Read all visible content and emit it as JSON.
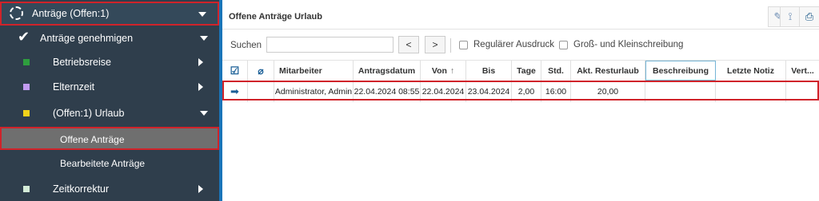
{
  "sidebar": {
    "top_label": "Anträge (Offen:1)",
    "approve_label": "Anträge genehmigen",
    "items": [
      {
        "label": "Betriebsreise",
        "color": "#2e9e3e"
      },
      {
        "label": "Elternzeit",
        "color": "#c29bf0"
      },
      {
        "label": "(Offen:1) Urlaub",
        "color": "#f2d21a"
      }
    ],
    "sub_open": "Offene Anträge",
    "sub_processed": "Bearbeitete Anträge",
    "zeitkorrektur": {
      "label": "Zeitkorrektur",
      "color": "#d4ecd8"
    }
  },
  "main": {
    "title": "Offene Anträge Urlaub",
    "search_label": "Suchen",
    "search_value": "",
    "prev": "<",
    "next": ">",
    "cb_regular": "Regulärer Ausdruck",
    "cb_case": "Groß- und Kleinschreibung"
  },
  "table": {
    "headers": [
      "Mitarbeiter",
      "Antragsdatum",
      "Von",
      "Bis",
      "Tage",
      "Std.",
      "Akt. Resturlaub",
      "Beschreibung",
      "Letzte Notiz",
      "Vert..."
    ],
    "sort_indicator": "↑",
    "row": [
      "Administrator, Admin",
      "22.04.2024 08:55",
      "22.04.2024",
      "23.04.2024",
      "2,00",
      "16:00",
      "20,00",
      "",
      "",
      ""
    ]
  }
}
